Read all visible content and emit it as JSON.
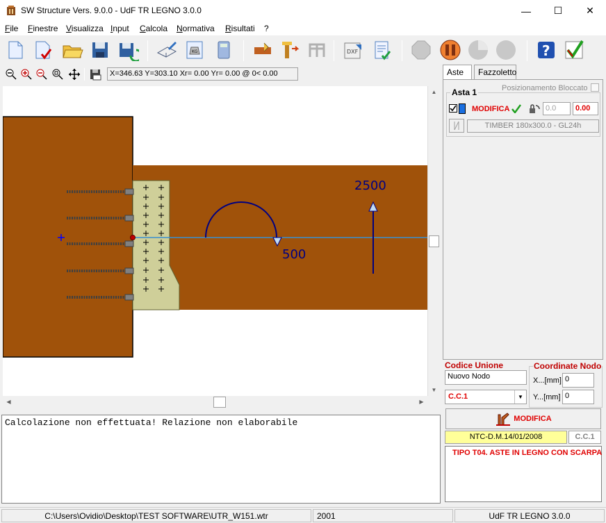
{
  "window": {
    "title": "SW Structure Vers. 9.0.0 - UdF TR LEGNO 3.0.0",
    "controls": {
      "minimize": "—",
      "maximize": "☐",
      "close": "✕"
    }
  },
  "menu": [
    {
      "label": "File",
      "accel": "F"
    },
    {
      "label": "Finestre",
      "accel": "F"
    },
    {
      "label": "Visualizza",
      "accel": "V"
    },
    {
      "label": "Input",
      "accel": "I"
    },
    {
      "label": "Calcola",
      "accel": "C"
    },
    {
      "label": "Normativa",
      "accel": "N"
    },
    {
      "label": "Risultati",
      "accel": "R"
    },
    {
      "label": "?",
      "accel": ""
    }
  ],
  "view": {
    "coord_readout": "X=346.63 Y=303.10 Xr= 0.00 Yr= 0.00 @  0< 0.00"
  },
  "drawing": {
    "moment_label": "500",
    "force_label": "2500",
    "colors": {
      "wood": "#a0520a",
      "plate": "#cfcf99",
      "axis": "#3a8fd0",
      "load": "#000080"
    }
  },
  "messages": {
    "status_msg": "Calcolazione non effettuata! Relazione non elaborabile"
  },
  "panel": {
    "tabs": [
      "Aste",
      "Fazzoletto"
    ],
    "posizionamento_label": "Posizionamento Bloccato",
    "asta_title": "Asta 1",
    "modifica_label": "MODIFICA",
    "angle_value": "0.0",
    "offset_value": "0.00",
    "section_label": "TIMBER 180x300.0 - GL24h",
    "codice_label": "Codice Unione",
    "codice_value": "Nuovo Nodo",
    "combo_value": "C.C.1",
    "coord_title": "Coordinate Nodo",
    "x_label": "X...[mm]",
    "x_value": "0",
    "y_label": "Y...[mm]",
    "y_value": "0",
    "modifica_label2": "MODIFICA",
    "normativa": "NTC-D.M.14/01/2008",
    "cc_label": "C.C.1",
    "tipo_text": "TIPO T04. ASTE IN LEGNO CON SCARPA"
  },
  "statusbar": {
    "path": "C:\\Users\\Ovidio\\Desktop\\TEST SOFTWARE\\UTR_W151.wtr",
    "code": "2001",
    "module": "UdF TR LEGNO 3.0.0"
  }
}
